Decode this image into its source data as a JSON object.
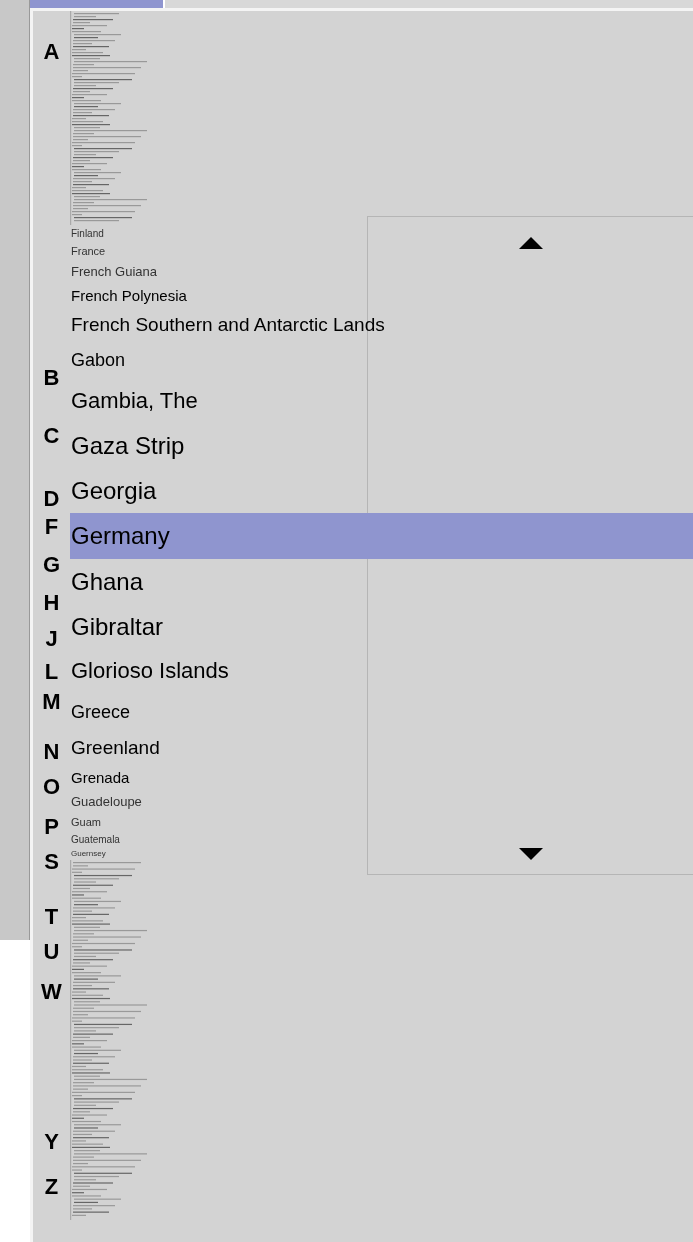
{
  "index_letters": [
    "A",
    "B",
    "C",
    "D",
    "F",
    "G",
    "H",
    "J",
    "L",
    "M",
    "N",
    "O",
    "P",
    "S",
    "T",
    "U",
    "W",
    "Y",
    "Z"
  ],
  "list": {
    "items": [
      {
        "label": "Finland",
        "selected": false
      },
      {
        "label": "France",
        "selected": false
      },
      {
        "label": "French Guiana",
        "selected": false
      },
      {
        "label": "French Polynesia",
        "selected": false
      },
      {
        "label": "French Southern and Antarctic Lands",
        "selected": false
      },
      {
        "label": "Gabon",
        "selected": false
      },
      {
        "label": "Gambia, The",
        "selected": false
      },
      {
        "label": "Gaza Strip",
        "selected": false
      },
      {
        "label": "Georgia",
        "selected": false
      },
      {
        "label": "Germany",
        "selected": true
      },
      {
        "label": "Ghana",
        "selected": false
      },
      {
        "label": "Gibraltar",
        "selected": false
      },
      {
        "label": "Glorioso Islands",
        "selected": false
      },
      {
        "label": "Greece",
        "selected": false
      },
      {
        "label": "Greenland",
        "selected": false
      },
      {
        "label": "Grenada",
        "selected": false
      },
      {
        "label": "Guadeloupe",
        "selected": false
      },
      {
        "label": "Guam",
        "selected": false
      },
      {
        "label": "Guatemala",
        "selected": false
      },
      {
        "label": "Guernsey",
        "selected": false
      }
    ]
  }
}
